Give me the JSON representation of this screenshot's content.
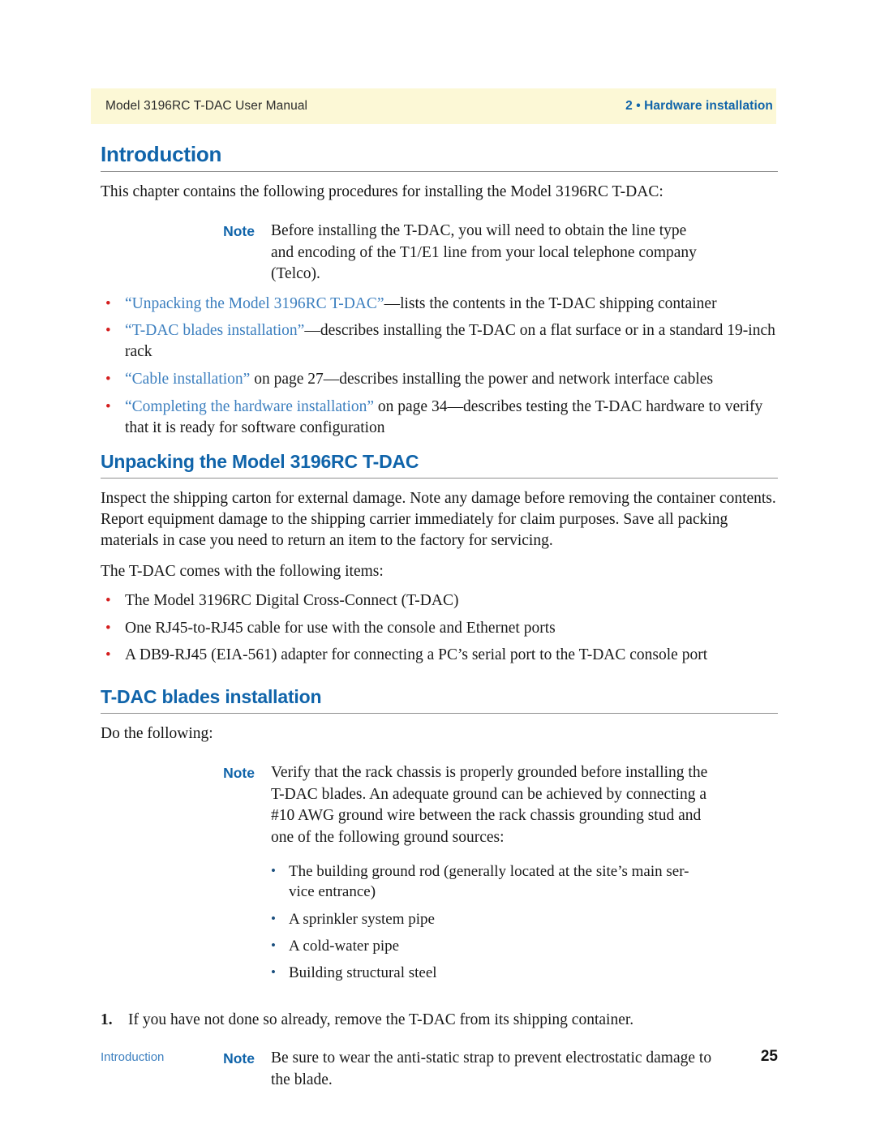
{
  "header": {
    "left_text": "Model 3196RC T-DAC User Manual",
    "right_text": "2 • Hardware installation",
    "band_color": "#fcf8d6",
    "accent_blue": "#1064aa"
  },
  "sections": [
    {
      "heading": "Introduction",
      "intro_paragraph": "This chapter contains the following procedures for installing the Model 3196RC T-DAC:",
      "note": {
        "label": "Note",
        "text": "Before installing the T-DAC, you will need to obtain the line type and encoding of the T1/E1 line from your local telephone company (Telco)."
      },
      "bullets": [
        {
          "xref": "“Unpacking the Model 3196RC T-DAC”",
          "rest": "—lists the contents in the T-DAC shipping container"
        },
        {
          "xref": "“T-DAC blades installation”",
          "rest": "—describes installing the T-DAC on a flat surface or in a standard 19-inch rack"
        },
        {
          "xref": "“Cable installation”",
          "rest": " on page 27—describes installing the power and network interface cables"
        },
        {
          "xref": "“Completing the hardware installation”",
          "rest": " on page 34—describes testing the T-DAC hardware to verify that it is ready for software configuration"
        }
      ]
    },
    {
      "heading": "Unpacking the Model 3196RC T-DAC",
      "paragraph_1": "Inspect the shipping carton for external damage. Note any damage before removing the container contents. Report equipment damage to the shipping carrier immediately for claim purposes. Save all packing materials in case you need to return an item to the factory for servicing.",
      "paragraph_2": "The T-DAC comes with the following items:",
      "bullets": [
        "The Model 3196RC Digital Cross-Connect (T-DAC)",
        "One RJ45-to-RJ45 cable for use with the console and Ethernet ports",
        "A DB9-RJ45 (EIA-561) adapter for connecting a PC’s serial port to the T-DAC console port"
      ]
    },
    {
      "heading": "T-DAC blades installation",
      "paragraph_1": "Do the following:",
      "note": {
        "label": "Note",
        "text": "Verify that the rack chassis is properly grounded before installing the T-DAC blades. An adequate ground can be achieved by connecting a #10 AWG ground wire between the rack chassis grounding stud and one of the following ground sources:",
        "sub_bullets": [
          "The building ground rod (generally located at the site’s main ser-vice entrance)",
          "A sprinkler system pipe",
          "A cold-water pipe",
          "Building structural steel"
        ]
      },
      "step": {
        "number": "1.",
        "text": "If you have not done so already, remove the T-DAC from its shipping container."
      },
      "note_2": {
        "label": "Note",
        "text": "Be sure to wear the anti-static strap to prevent electrostatic damage to the blade."
      }
    }
  ],
  "footer": {
    "left_text": "Introduction",
    "page_number": "25"
  },
  "colors": {
    "heading_blue": "#1064aa",
    "link_blue": "#3c7fbf",
    "bullet_red": "#d41f1f",
    "bullet_dark_blue": "#1b4f7e",
    "rule_gray": "#8f8f8f"
  }
}
